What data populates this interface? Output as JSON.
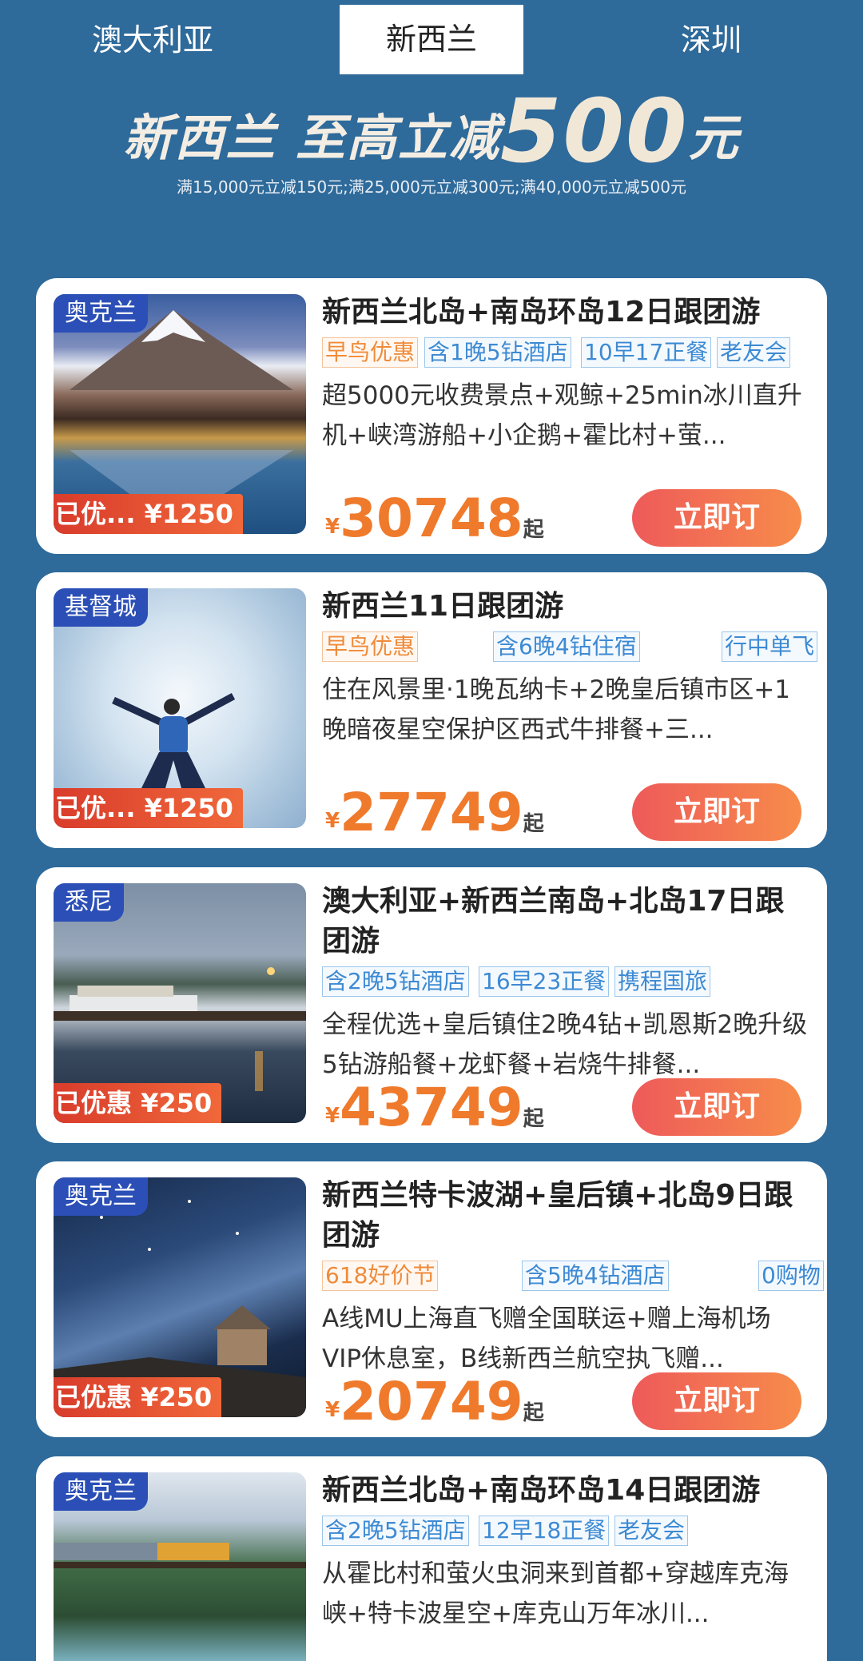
{
  "tabs": [
    {
      "label": "澳大利亚"
    },
    {
      "label": "新西兰"
    },
    {
      "label": "深圳"
    }
  ],
  "banner": {
    "title_a": "新西兰 至高立减",
    "title_amount": "500",
    "title_unit": "元",
    "subtitle": "满15,000元立减150元;满25,000元立减300元;满40,000元立减500元"
  },
  "cards": [
    {
      "location": "奥克兰",
      "discount": "已优... ¥1250",
      "title": "新西兰北岛+南岛环岛12日跟团游",
      "tags": [
        "早鸟优惠",
        "含1晚5钻酒店",
        "10早17正餐",
        "老友会"
      ],
      "desc": "超5000元收费景点+观鲸+25min冰川直升机+峡湾游船+小企鹅+霍比村+萤...",
      "currency": "¥",
      "price": "30748",
      "price_suffix": "起",
      "button": "立即订"
    },
    {
      "location": "基督城",
      "discount": "已优... ¥1250",
      "title": "新西兰11日跟团游",
      "tags": [
        "早鸟优惠",
        "含6晚4钻住宿",
        "行中单飞"
      ],
      "desc": "住在风景里·1晚瓦纳卡+2晚皇后镇市区+1晚暗夜星空保护区西式牛排餐+三...",
      "currency": "¥",
      "price": "27749",
      "price_suffix": "起",
      "button": "立即订"
    },
    {
      "location": "悉尼",
      "discount": "已优惠 ¥250",
      "title": "澳大利亚+新西兰南岛+北岛17日跟团游",
      "tags": [
        "含2晚5钻酒店",
        "16早23正餐",
        "携程国旅"
      ],
      "desc": "全程优选+皇后镇住2晚4钻+凯恩斯2晚升级5钻游船餐+龙虾餐+岩烧牛排餐...",
      "currency": "¥",
      "price": "43749",
      "price_suffix": "起",
      "button": "立即订"
    },
    {
      "location": "奥克兰",
      "discount": "已优惠 ¥250",
      "title": "新西兰特卡波湖+皇后镇+北岛9日跟团游",
      "tags": [
        "618好价节",
        "含5晚4钻酒店",
        "0购物"
      ],
      "desc": "A线MU上海直飞赠全国联运+赠上海机场VIP休息室，B线新西兰航空执飞赠...",
      "currency": "¥",
      "price": "20749",
      "price_suffix": "起",
      "button": "立即订"
    },
    {
      "location": "奥克兰",
      "title": "新西兰北岛+南岛环岛14日跟团游",
      "tags": [
        "含2晚5钻酒店",
        "12早18正餐",
        "老友会"
      ],
      "desc": "从霍比村和萤火虫洞来到首都+穿越库克海峡+特卡波星空+库克山万年冰川..."
    }
  ],
  "colors": {
    "background": "#2e6a9a",
    "price": "#ef7a2c",
    "location_badge": "#2b4fb6",
    "tag_blue": "#3d8ad3",
    "tag_orange": "#ef8b3a"
  }
}
